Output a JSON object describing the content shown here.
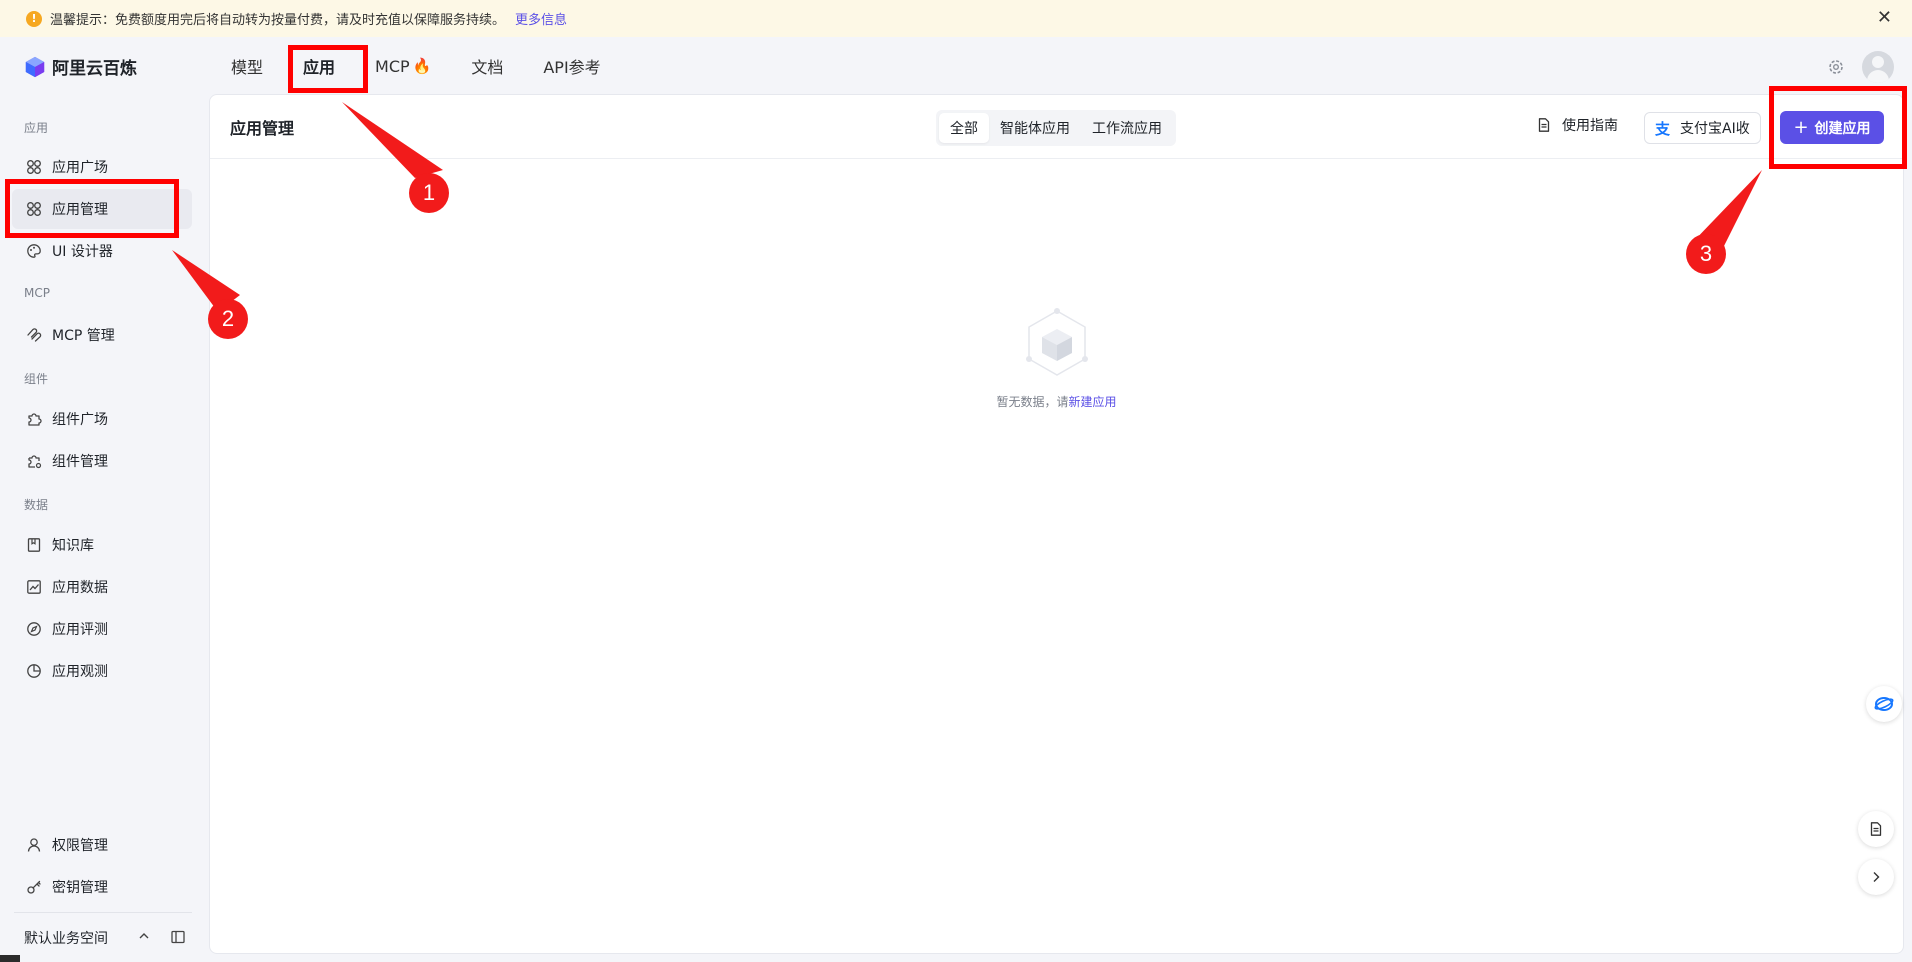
{
  "notice": {
    "text": "温馨提示：免费额度用完后将自动转为按量付费，请及时充值以保障服务持续。",
    "link": "更多信息"
  },
  "brand": {
    "name": "阿里云百炼"
  },
  "topnav": {
    "tabs": [
      "模型",
      "应用",
      "MCP",
      "文档",
      "API参考"
    ],
    "active": "应用"
  },
  "sidebar": {
    "sections": {
      "app": "应用",
      "mcp": "MCP",
      "component": "组件",
      "data": "数据"
    },
    "items": {
      "app_plaza": "应用广场",
      "app_manage": "应用管理",
      "ui_designer": "UI 设计器",
      "mcp_manage": "MCP 管理",
      "comp_plaza": "组件广场",
      "comp_manage": "组件管理",
      "knowledge": "知识库",
      "app_data": "应用数据",
      "app_eval": "应用评测",
      "app_observe": "应用观测",
      "permission": "权限管理",
      "secret": "密钥管理"
    },
    "workspace": "默认业务空间"
  },
  "main": {
    "title": "应用管理",
    "filters": [
      "全部",
      "智能体应用",
      "工作流应用"
    ],
    "active_filter": "全部",
    "guide": "使用指南",
    "alipay_label": "支付宝AI收",
    "alipay_glyph": "支",
    "create": "创建应用",
    "empty_text": "暂无数据，请",
    "empty_link": "新建应用"
  },
  "annotations": {
    "callouts": [
      "1",
      "2",
      "3"
    ],
    "color": "#ff0000"
  },
  "colors": {
    "accent": "#5b50e6",
    "notice_bg": "#fdf8e6",
    "warn": "#f6a821"
  }
}
